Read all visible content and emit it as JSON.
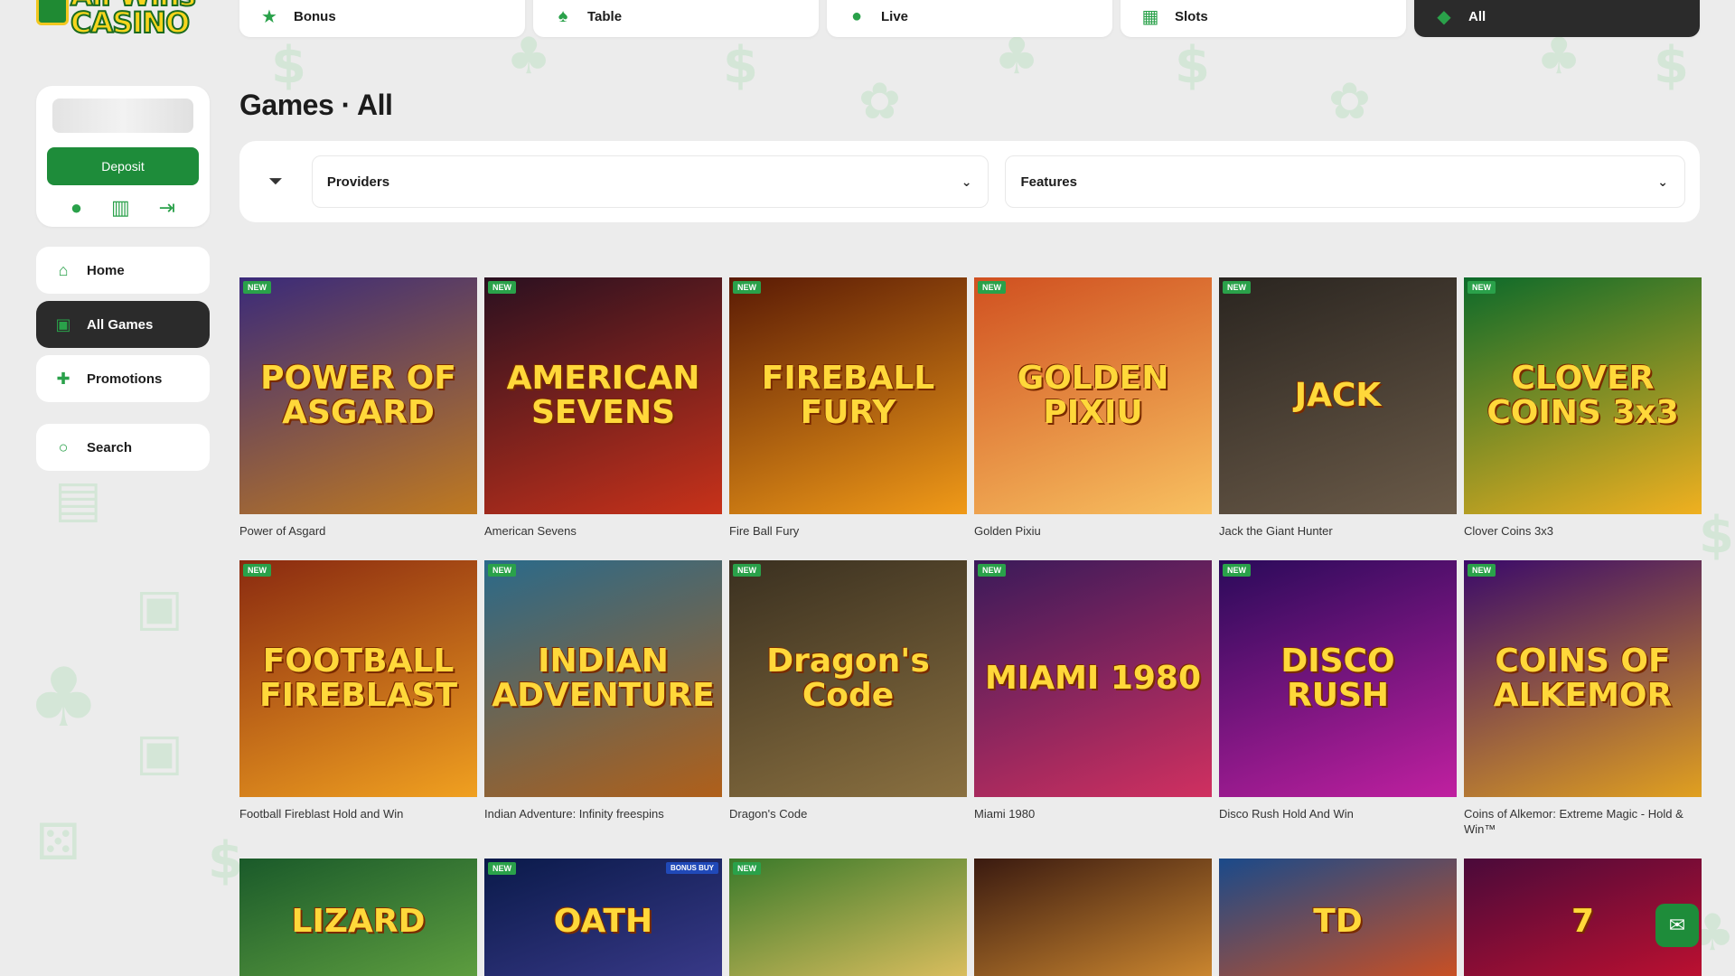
{
  "logo": {
    "text": "All Wins CASINO"
  },
  "account": {
    "deposit_label": "Deposit",
    "icons": [
      "user-icon",
      "coupon-icon",
      "logout-icon"
    ]
  },
  "sidebar": {
    "items": [
      {
        "label": "Home",
        "icon": "home-icon"
      },
      {
        "label": "All Games",
        "icon": "games-icon",
        "active": true
      },
      {
        "label": "Promotions",
        "icon": "gift-icon"
      }
    ],
    "search_label": "Search"
  },
  "tabs": [
    {
      "label": "Bonus",
      "icon": "bonus-icon"
    },
    {
      "label": "Table",
      "icon": "cards-icon"
    },
    {
      "label": "Live",
      "icon": "dealer-icon"
    },
    {
      "label": "Slots",
      "icon": "slots-icon"
    },
    {
      "label": "All",
      "icon": "all-icon",
      "active": true
    }
  ],
  "page_title": "Games · All",
  "filters": {
    "providers_label": "Providers",
    "features_label": "Features"
  },
  "badge_new": "NEW",
  "badge_bonus_buy": "BONUS BUY",
  "games_row1": [
    {
      "name": "Power of Asgard",
      "art": "POWER OF ASGARD",
      "bg": "#3a2a7a",
      "bg2": "#c07a20"
    },
    {
      "name": "American Sevens",
      "art": "AMERICAN SEVENS",
      "bg": "#2a1020",
      "bg2": "#c8321a"
    },
    {
      "name": "Fire Ball Fury",
      "art": "FIREBALL FURY",
      "bg": "#5a1a05",
      "bg2": "#f09a18"
    },
    {
      "name": "Golden Pixiu",
      "art": "GOLDEN PIXIU",
      "bg": "#d05020",
      "bg2": "#f8c060"
    },
    {
      "name": "Jack the Giant Hunter",
      "art": "JACK",
      "bg": "#2a2520",
      "bg2": "#6a5a48"
    },
    {
      "name": "Clover Coins 3x3",
      "art": "CLOVER COINS 3x3",
      "bg": "#0c6a2a",
      "bg2": "#f0b020"
    }
  ],
  "games_row2": [
    {
      "name": "Football Fireblast Hold and Win",
      "art": "FOOTBALL FIREBLAST",
      "bg": "#8a2a10",
      "bg2": "#f0a020"
    },
    {
      "name": "Indian Adventure: Infinity freespins",
      "art": "INDIAN ADVENTURE",
      "bg": "#2a6a8a",
      "bg2": "#b0601a"
    },
    {
      "name": "Dragon's Code",
      "art": "Dragon's Code",
      "bg": "#3a3020",
      "bg2": "#8a7040"
    },
    {
      "name": "Miami 1980",
      "art": "MIAMI 1980",
      "bg": "#3a1a5a",
      "bg2": "#d03060"
    },
    {
      "name": "Disco Rush Hold And Win",
      "art": "DISCO RUSH",
      "bg": "#2a0a5a",
      "bg2": "#c020a0"
    },
    {
      "name": "Coins of Alkemor: Extreme Magic - Hold & Win™",
      "art": "COINS OF ALKEMOR",
      "bg": "#3a0a6a",
      "bg2": "#e0a020"
    }
  ],
  "games_row3": [
    {
      "art": "LIZARD",
      "bg": "#1a5a2a",
      "bg2": "#60a040"
    },
    {
      "art": "OATH",
      "bg": "#0a1a4a",
      "bg2": "#3a3a8a",
      "bonus": true
    },
    {
      "art": "",
      "bg": "#3a7a2a",
      "bg2": "#e0c060"
    },
    {
      "art": "",
      "bg": "#3a1a10",
      "bg2": "#d08a30"
    },
    {
      "art": "TD",
      "bg": "#1a4a8a",
      "bg2": "#d05020"
    },
    {
      "art": "7",
      "bg": "#4a0a3a",
      "bg2": "#c01030"
    }
  ]
}
